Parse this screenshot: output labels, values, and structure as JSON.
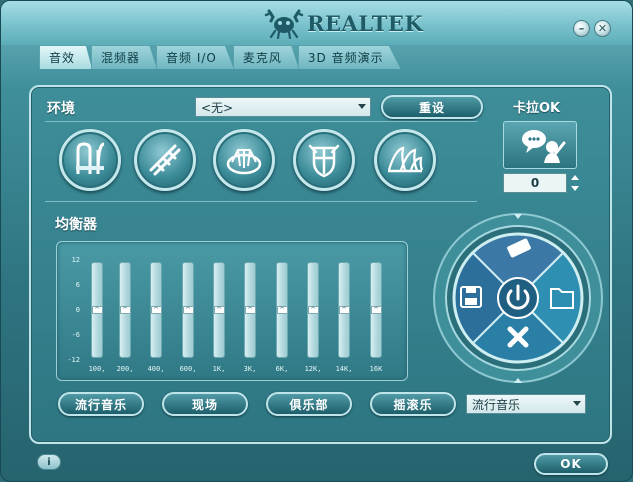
{
  "title": {
    "brand": "REALTEK"
  },
  "tabs": [
    {
      "label": "音效",
      "active": true
    },
    {
      "label": "混频器",
      "active": false
    },
    {
      "label": "音频 I/O",
      "active": false
    },
    {
      "label": "麦克风",
      "active": false
    },
    {
      "label": "3D 音频演示",
      "active": false
    }
  ],
  "environment": {
    "label": "环境",
    "selected": "<无>",
    "reset_label": "重设",
    "presets": [
      "bathroom-icon",
      "stone-corridor-icon",
      "stadium-icon",
      "colosseum-icon",
      "opera-house-icon"
    ]
  },
  "karaoke": {
    "label": "卡拉OK",
    "value": "0"
  },
  "equalizer": {
    "label": "均衡器",
    "scale": [
      "12",
      "6",
      "0",
      "-6",
      "-12"
    ],
    "bands": [
      {
        "freq": "100,",
        "value": 0
      },
      {
        "freq": "200,",
        "value": 0
      },
      {
        "freq": "400,",
        "value": 0
      },
      {
        "freq": "600,",
        "value": 0
      },
      {
        "freq": "1K,",
        "value": 0
      },
      {
        "freq": "3K,",
        "value": 0
      },
      {
        "freq": "6K,",
        "value": 0
      },
      {
        "freq": "12K,",
        "value": 0
      },
      {
        "freq": "14K,",
        "value": 0
      },
      {
        "freq": "16K",
        "value": 0
      }
    ],
    "presets": [
      "流行音乐",
      "现场",
      "俱乐部",
      "摇滚乐"
    ],
    "preset_selected": "流行音乐"
  },
  "wheel": {
    "icons": [
      "eraser-icon",
      "save-icon",
      "power-icon",
      "folder-icon",
      "delete-icon"
    ]
  },
  "footer": {
    "info": "i",
    "ok_label": "OK"
  },
  "colors": {
    "panel": "#2e7480",
    "accent": "#bfe5ea",
    "title_band": "#79c2cc"
  }
}
